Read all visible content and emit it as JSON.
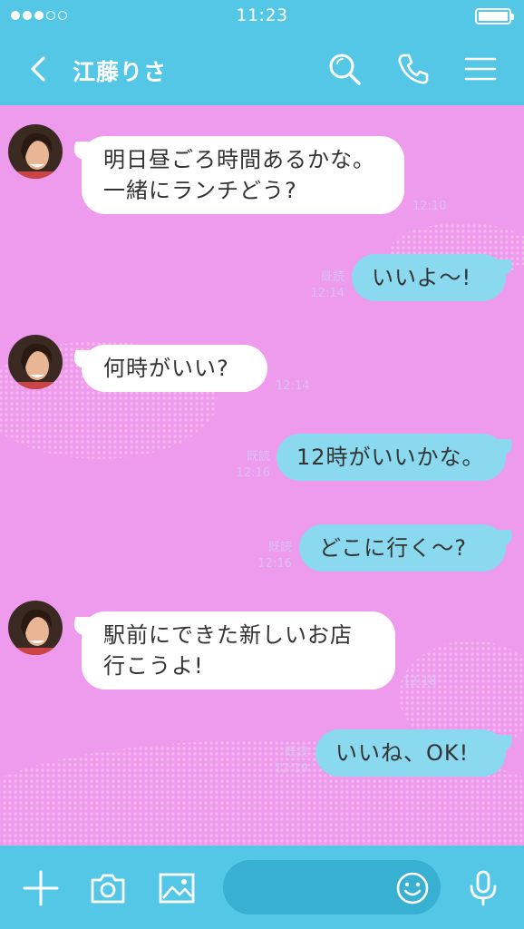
{
  "status_bar": {
    "time": "11:23",
    "signal_dots_filled": 3,
    "signal_dots_total": 5
  },
  "header": {
    "title": "江藤りさ",
    "icons": {
      "back": "chevron-left-icon",
      "search": "search-icon",
      "call": "phone-icon",
      "menu": "hamburger-menu-icon"
    }
  },
  "messages": [
    {
      "side": "in",
      "lines": [
        "明日昼ごろ時間あるかな。",
        "一緒にランチどう?"
      ],
      "time": "12:10"
    },
    {
      "side": "out",
      "text": "いいよ〜!",
      "read": "既読",
      "time": "12:14"
    },
    {
      "side": "in",
      "text": "何時がいい?",
      "time": "12:14"
    },
    {
      "side": "out",
      "text": "12時がいいかな。",
      "read": "既読",
      "time": "12:16"
    },
    {
      "side": "out",
      "text": "どこに行く〜?",
      "read": "既読",
      "time": "12:16"
    },
    {
      "side": "in",
      "lines": [
        "駅前にできた新しいお店",
        "行こうよ!"
      ],
      "time": "12:18"
    },
    {
      "side": "out",
      "text": "いいね、OK!",
      "read": "既読",
      "time": "12:19"
    }
  ],
  "input_bar": {
    "message_value": "",
    "icons": {
      "add": "plus-icon",
      "camera": "camera-icon",
      "photo": "image-icon",
      "sticker": "smiley-icon",
      "voice": "microphone-icon"
    }
  },
  "colors": {
    "header_bg": "#54c7e6",
    "chat_bg": "#ee9aed",
    "outgoing_bubble": "#8ad9ef",
    "incoming_bubble": "#ffffff"
  }
}
